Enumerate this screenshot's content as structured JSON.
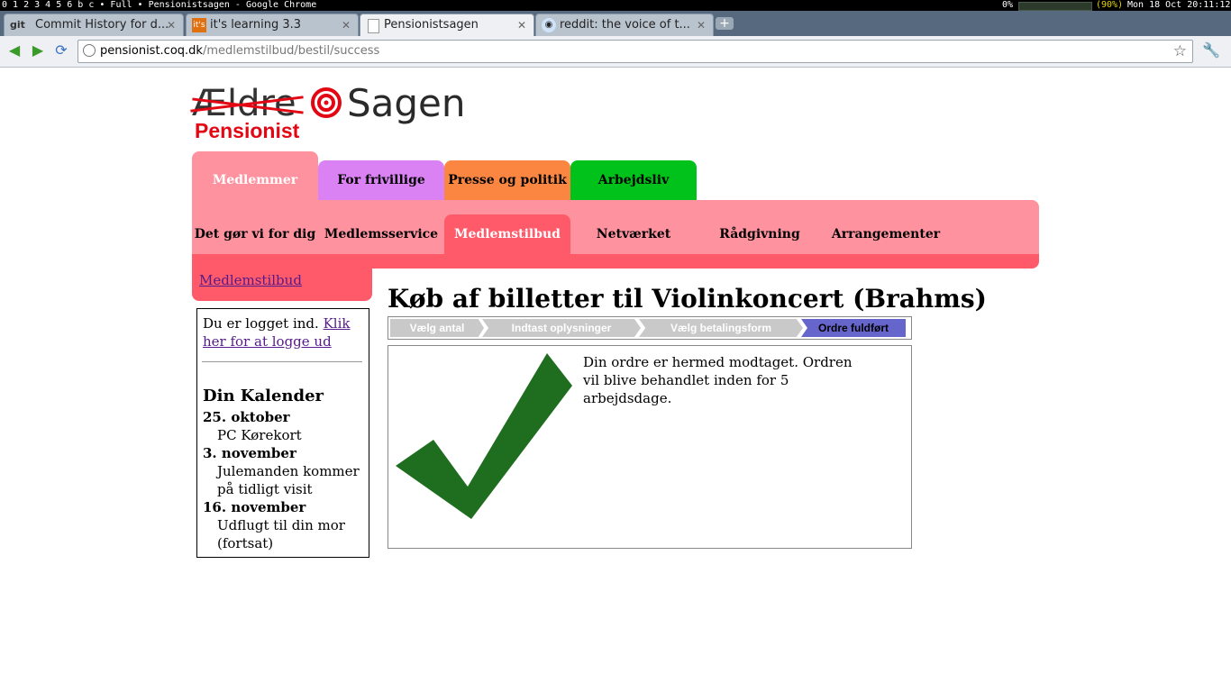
{
  "system_bar": {
    "workspaces": "0 1 2 3 4 5 6 b c",
    "layout": "Full",
    "window_title": "Pensionistsagen - Google Chrome",
    "cpu": "0%",
    "battery": "(90%)",
    "datetime": "Mon 18 Oct 20:11:12"
  },
  "tabs": [
    {
      "favicon": "git",
      "title": "Commit History for d..."
    },
    {
      "favicon": "it's",
      "title": "it's learning 3.3"
    },
    {
      "favicon": "doc",
      "title": "Pensionistsagen"
    },
    {
      "favicon": "reddit",
      "title": "reddit: the voice of t..."
    }
  ],
  "toolbar": {
    "url_host": "pensionist.coq.dk",
    "url_path": "/medlemstilbud/bestil/success"
  },
  "logo": {
    "crossed": "Ældre",
    "name": "Sagen",
    "sub": "Pensionist"
  },
  "main_tabs": [
    "Medlemmer",
    "For frivillige",
    "Presse og politik",
    "Arbejdsliv"
  ],
  "sub_nav": [
    "Det gør vi for dig",
    "Medlemsservice",
    "Medlemstilbud",
    "Netværket",
    "Rådgivning",
    "Arrangementer"
  ],
  "section_link": "Medlemstilbud",
  "sidebar": {
    "login_text": "Du er logget ind.",
    "logout_link": "Klik her for at logge ud",
    "calendar_title": "Din Kalender",
    "events": [
      {
        "date": "25. oktober",
        "text": "PC Kørekort"
      },
      {
        "date": "3. november",
        "text": "Julemanden kommer på tidligt visit"
      },
      {
        "date": "16. november",
        "text": "Udflugt til din mor (fortsat)"
      }
    ]
  },
  "page": {
    "title": "Køb af billetter til Violinkoncert (Brahms)",
    "steps": [
      "Vælg antal",
      "Indtast oplysninger",
      "Vælg betalingsform",
      "Ordre fuldført"
    ],
    "message": "Din ordre er hermed modtaget. Ordren vil blive behandlet inden for 5 arbejdsdage."
  },
  "colors": {
    "medlemmer": "#ff929f",
    "frivillige": "#da82f4",
    "presse": "#fb8641",
    "arbejdsliv": "#00c21a",
    "active_sub": "#ff5a6a",
    "step_done": "#6565cc",
    "check": "#1f6e1f"
  }
}
